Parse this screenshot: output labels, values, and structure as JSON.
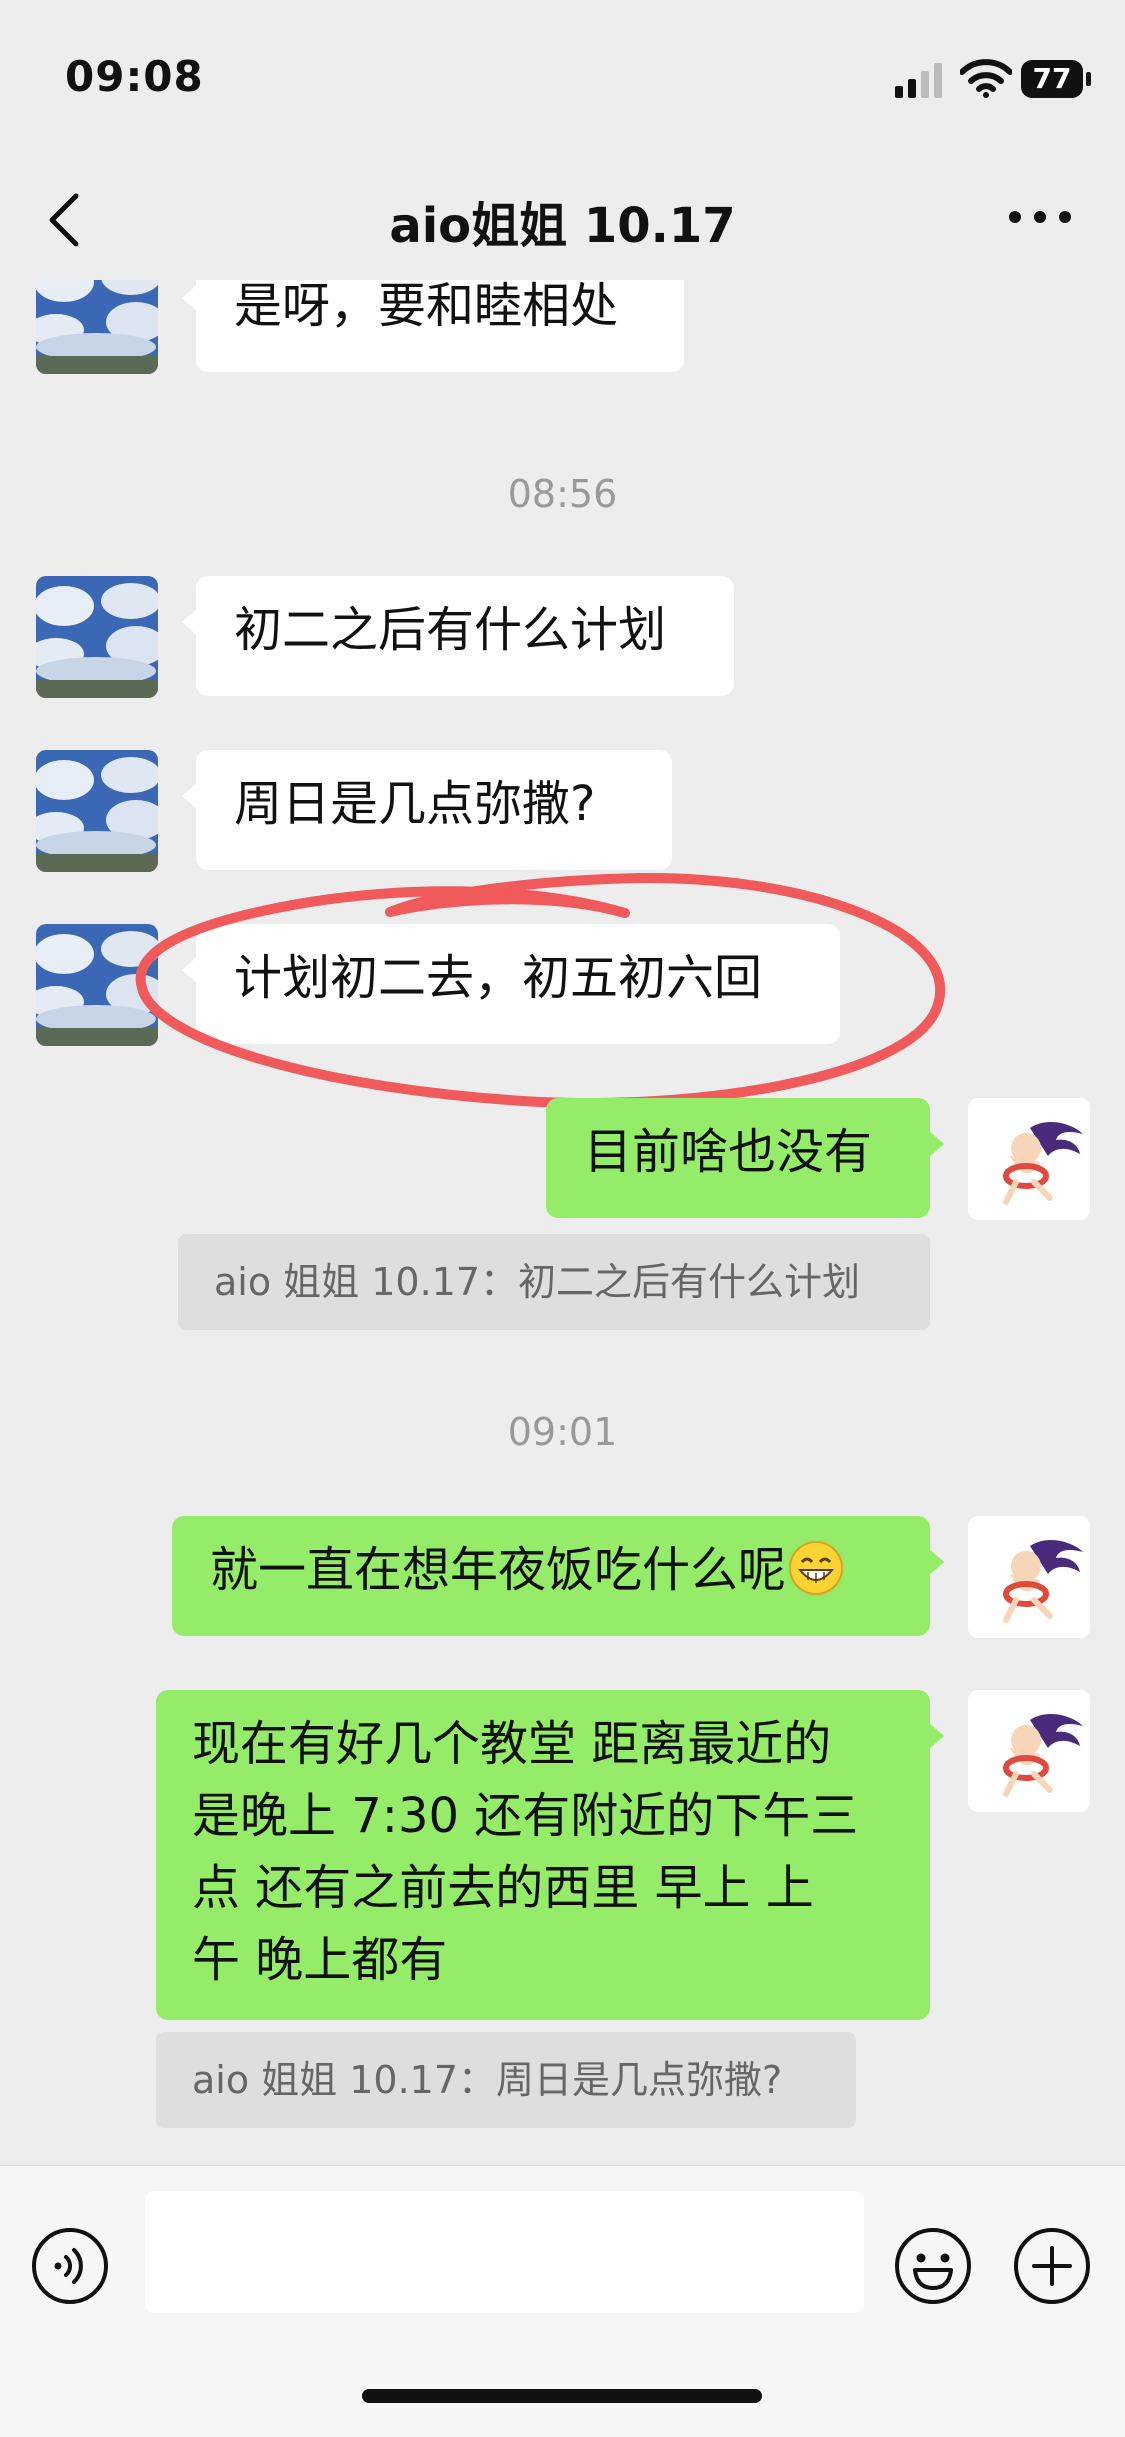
{
  "status_bar": {
    "time": "09:08",
    "battery": "77"
  },
  "nav": {
    "title": "aio姐姐 10.17"
  },
  "messages": [
    {
      "side": "in",
      "text": "是呀，要和睦相处"
    },
    {
      "type": "timestamp",
      "text": "08:56"
    },
    {
      "side": "in",
      "text": "初二之后有什么计划"
    },
    {
      "side": "in",
      "text": "周日是几点弥撒?"
    },
    {
      "side": "in",
      "text": "计划初二去，初五初六回",
      "annotation": "red-circle"
    },
    {
      "side": "out",
      "text": "目前啥也没有"
    },
    {
      "type": "quote",
      "text": "aio 姐姐 10.17：初二之后有什么计划"
    },
    {
      "type": "timestamp",
      "text": "09:01"
    },
    {
      "side": "out",
      "text": "就一直在想年夜饭吃什么呢",
      "emoji": "grinning-face"
    },
    {
      "side": "out",
      "lines": [
        "现在有好几个教堂  距离最近的",
        "是晚上 7:30 还有附近的下午三",
        "点  还有之前去的西里  早上  上",
        "午  晚上都有"
      ]
    },
    {
      "type": "quote",
      "text": "aio 姐姐 10.17：周日是几点弥撒?"
    }
  ],
  "input": {
    "placeholder": ""
  },
  "colors": {
    "background": "#ededed",
    "outgoing_bubble": "#95ec69",
    "incoming_bubble": "#ffffff",
    "annotation": "#f05a5a"
  }
}
